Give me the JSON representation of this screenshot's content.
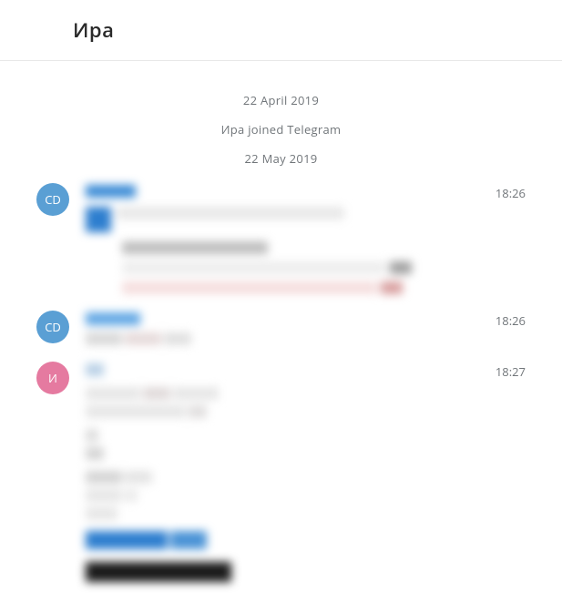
{
  "header": {
    "title": "Ира"
  },
  "service": {
    "date1": "22 April 2019",
    "joined": "Ира joined Telegram",
    "date2": "22 May 2019"
  },
  "messages": [
    {
      "avatar_initials": "CD",
      "avatar_color": "blue",
      "time": "18:26"
    },
    {
      "avatar_initials": "CD",
      "avatar_color": "blue",
      "time": "18:26"
    },
    {
      "avatar_initials": "И",
      "avatar_color": "pink",
      "time": "18:27"
    }
  ]
}
